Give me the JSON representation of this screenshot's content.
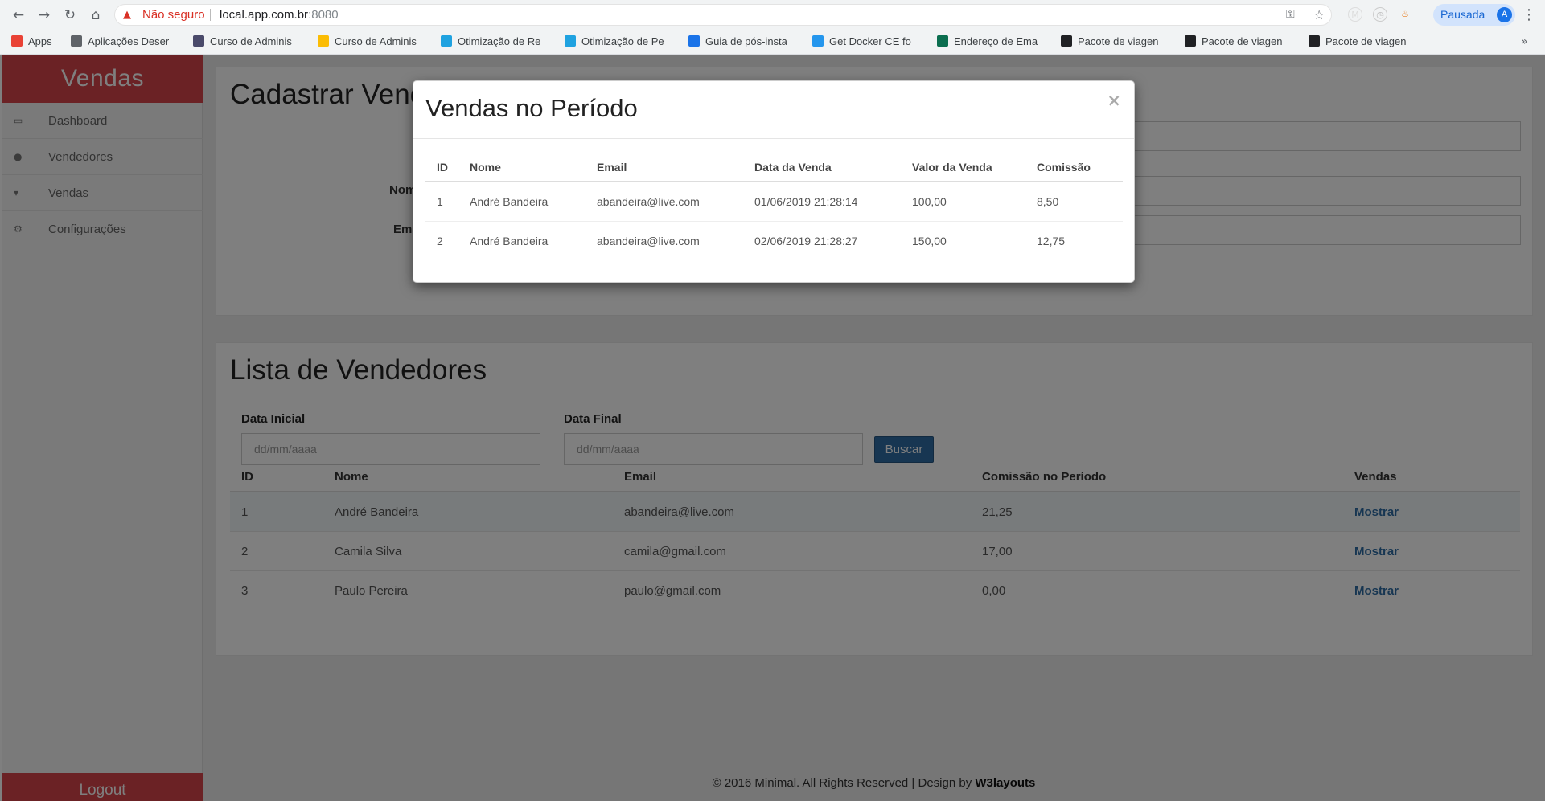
{
  "browser": {
    "security_label": "Não seguro",
    "url_host": "local.app.com.br",
    "url_port": ":8080",
    "profile_label": "Pausada",
    "profile_initial": "A",
    "bookmarks": [
      {
        "label": "Apps",
        "color": "#e94235"
      },
      {
        "label": "Aplicações Deser",
        "color": "#5f6368"
      },
      {
        "label": "Curso de Adminis",
        "color": "#4a4a6a"
      },
      {
        "label": "Curso de Adminis",
        "color": "#fbbc04"
      },
      {
        "label": "Otimização de Re",
        "color": "#1fa2e0"
      },
      {
        "label": "Otimização de Pe",
        "color": "#1fa2e0"
      },
      {
        "label": "Guia de pós-insta",
        "color": "#1a73e8"
      },
      {
        "label": "Get Docker CE fo",
        "color": "#2496ed"
      },
      {
        "label": "Endereço de Ema",
        "color": "#0b6e4f"
      },
      {
        "label": "Pacote de viagen",
        "color": "#202124"
      },
      {
        "label": "Pacote de viagen",
        "color": "#202124"
      },
      {
        "label": "Pacote de viagen",
        "color": "#202124"
      }
    ]
  },
  "sidebar": {
    "brand": "Vendas",
    "items": [
      {
        "label": "Dashboard",
        "icon": "desktop-icon"
      },
      {
        "label": "Vendedores",
        "icon": "user-icon"
      },
      {
        "label": "Vendas",
        "icon": "cart-icon"
      },
      {
        "label": "Configurações",
        "icon": "gears-icon"
      }
    ],
    "logout": "Logout"
  },
  "cadastro": {
    "title": "Cadastrar Vendedor",
    "name_label": "Nome",
    "email_label": "Email"
  },
  "lista": {
    "title": "Lista de Vendedores",
    "data_inicial_label": "Data Inicial",
    "data_inicial_placeholder": "dd/mm/aaaa",
    "data_final_label": "Data Final",
    "data_final_placeholder": "dd/mm/aaaa",
    "buscar": "Buscar",
    "columns": [
      "ID",
      "Nome",
      "Email",
      "Comissão no Período",
      "Vendas"
    ],
    "rows": [
      {
        "id": "1",
        "nome": "André Bandeira",
        "email": "abandeira@live.com",
        "comissao": "21,25",
        "acao": "Mostrar"
      },
      {
        "id": "2",
        "nome": "Camila Silva",
        "email": "camila@gmail.com",
        "comissao": "17,00",
        "acao": "Mostrar"
      },
      {
        "id": "3",
        "nome": "Paulo Pereira",
        "email": "paulo@gmail.com",
        "comissao": "0,00",
        "acao": "Mostrar"
      }
    ]
  },
  "footer": {
    "text": "© 2016 Minimal. All Rights Reserved | Design by",
    "link": "W3layouts"
  },
  "modal": {
    "title": "Vendas no Período",
    "close": "×",
    "columns": [
      "ID",
      "Nome",
      "Email",
      "Data da Venda",
      "Valor da Venda",
      "Comissão"
    ],
    "rows": [
      {
        "id": "1",
        "nome": "André Bandeira",
        "email": "abandeira@live.com",
        "data": "01/06/2019 21:28:14",
        "valor": "100,00",
        "comissao": "8,50"
      },
      {
        "id": "2",
        "nome": "André Bandeira",
        "email": "abandeira@live.com",
        "data": "02/06/2019 21:28:27",
        "valor": "150,00",
        "comissao": "12,75"
      }
    ]
  }
}
